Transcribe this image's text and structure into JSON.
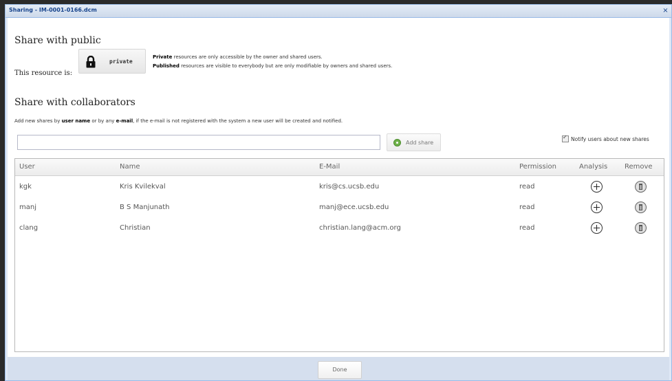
{
  "window": {
    "title": "Sharing - IM-0001-0166.dcm",
    "close_glyph": "×"
  },
  "public": {
    "heading": "Share with public",
    "resource_label": "This resource is:",
    "status_button": "private",
    "private_desc_bold": "Private",
    "private_desc_rest": " resources are only accessible by the owner and shared users.",
    "published_desc_bold": "Published",
    "published_desc_rest": " resources are visible to everybody but are only modifiable by owners and shared users."
  },
  "collab": {
    "heading": "Share with collaborators",
    "add_desc_1": "Add new shares by ",
    "add_desc_b1": "user name",
    "add_desc_2": " or by any ",
    "add_desc_b2": "e-mail",
    "add_desc_3": ", if the e-mail is not registered with the system a new user will be created and notified.",
    "input_value": "",
    "add_share_label": "Add share",
    "notify_label": "Notify users about new shares",
    "notify_checked": true
  },
  "grid": {
    "columns": [
      "User",
      "Name",
      "E-Mail",
      "Permission",
      "Analysis",
      "Remove"
    ],
    "rows": [
      {
        "user": "kgk",
        "name": "Kris Kvilekval",
        "email": "kris@cs.ucsb.edu",
        "permission": "read"
      },
      {
        "user": "manj",
        "name": "B S Manjunath",
        "email": "manj@ece.ucsb.edu",
        "permission": "read"
      },
      {
        "user": "clang",
        "name": "Christian",
        "email": "christian.lang@acm.org",
        "permission": "read"
      }
    ]
  },
  "footer": {
    "done_label": "Done"
  },
  "icons": {
    "lock": "lock-icon",
    "add": "add-icon",
    "analysis": "plus-circle-icon",
    "remove": "trash-icon",
    "close": "close-icon"
  },
  "colors": {
    "title_text": "#15428b",
    "window_bg": "#dfe8f6",
    "border": "#99bbe8"
  }
}
